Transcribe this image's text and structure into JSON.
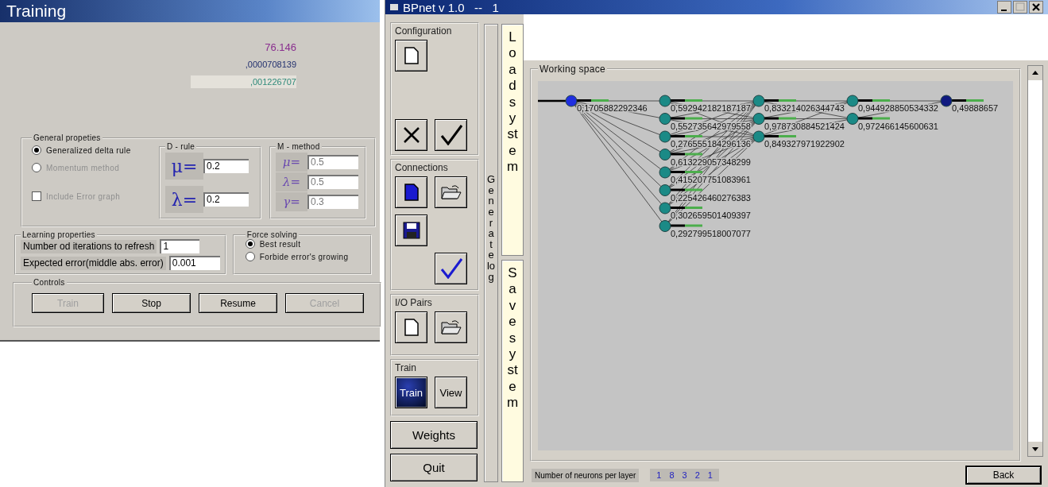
{
  "training": {
    "title": "Training",
    "readouts": [
      {
        "text": "76.146",
        "color": "#8a2f8f",
        "kind": "plain"
      },
      {
        "text": ",0000708139",
        "color": "#22306e",
        "kind": "plain"
      },
      {
        "text": ",001226707",
        "color": "#2f8a7a",
        "kind": "field"
      }
    ],
    "general": {
      "title": "General propeties",
      "radios": [
        {
          "label": "Generalized delta rule",
          "selected": true,
          "disabled": false
        },
        {
          "label": "Momentum method",
          "selected": false,
          "disabled": true
        }
      ],
      "checkbox": {
        "label": "Include Error graph",
        "checked": false,
        "disabled": true
      },
      "d_rule": {
        "title": "D - rule",
        "disabled": false,
        "params": [
          {
            "symbol": "μ=",
            "value": "0.2"
          },
          {
            "symbol": "λ=",
            "value": "0.2"
          }
        ]
      },
      "m_method": {
        "title": "M - method",
        "disabled": true,
        "params": [
          {
            "symbol": "μ=",
            "value": "0.5"
          },
          {
            "symbol": "λ=",
            "value": "0.5"
          },
          {
            "symbol": "γ=",
            "value": "0.3"
          }
        ]
      }
    },
    "learning": {
      "title": "Learning properties",
      "fields": [
        {
          "label": "Number od iterations to refresh",
          "value": "1"
        },
        {
          "label": "Expected error(middle abs. error)",
          "value": "0.001"
        }
      ]
    },
    "force": {
      "title": "Force solving",
      "radios": [
        {
          "label": "Best result",
          "selected": true
        },
        {
          "label": "Forbide error's growing",
          "selected": false
        }
      ]
    },
    "controls": {
      "title": "Controls",
      "buttons": [
        {
          "label": "Train",
          "disabled": true
        },
        {
          "label": "Stop",
          "disabled": false
        },
        {
          "label": "Resume",
          "disabled": false
        },
        {
          "label": "Cancel",
          "disabled": true
        }
      ]
    }
  },
  "bpnet": {
    "title": "BPnet v 1.0   --   1",
    "groups": [
      {
        "title": "Configuration",
        "buttons": [
          {
            "kind": "new"
          },
          {
            "kind": "cancel"
          },
          {
            "kind": "apply"
          }
        ]
      },
      {
        "title": "Connections",
        "buttons": [
          {
            "kind": "new-blue"
          },
          {
            "kind": "open"
          },
          {
            "kind": "save"
          },
          {
            "kind": "apply-blue"
          }
        ]
      },
      {
        "title": "I/O Pairs",
        "buttons": [
          {
            "kind": "new"
          },
          {
            "kind": "open"
          }
        ]
      },
      {
        "title": "Train",
        "buttons": [
          {
            "kind": "text",
            "label": "Train",
            "selected": true
          },
          {
            "kind": "text",
            "label": "View",
            "selected": false
          }
        ]
      }
    ],
    "bottom_buttons": [
      "Weights",
      "Quit"
    ],
    "generate_log": "Generate log",
    "load_system": "Load system",
    "save_system": "Save system",
    "working_space": {
      "title": "Working space",
      "layers": [
        {
          "kind": "input",
          "neurons": [
            "0,1705882292346"
          ]
        },
        {
          "kind": "hidden",
          "neurons": [
            "0,592942182187187",
            "0,552735642979558",
            "0,276555184296136",
            "0,613229057348299",
            "0,415207751083961",
            "0,225426460276383",
            "0,302659501409397",
            "0,292799518007077"
          ]
        },
        {
          "kind": "hidden",
          "neurons": [
            "0,833214026344743",
            "0,978730884521424",
            "0,849327971922902"
          ]
        },
        {
          "kind": "hidden",
          "neurons": [
            "0,944928850534332",
            "0,972466145600631"
          ]
        },
        {
          "kind": "output",
          "neurons": [
            "0,49888657"
          ]
        }
      ]
    },
    "status": {
      "label": "Number of neurons per layer",
      "counts": [
        "1",
        "8",
        "3",
        "2",
        "1"
      ]
    },
    "back": "Back"
  }
}
